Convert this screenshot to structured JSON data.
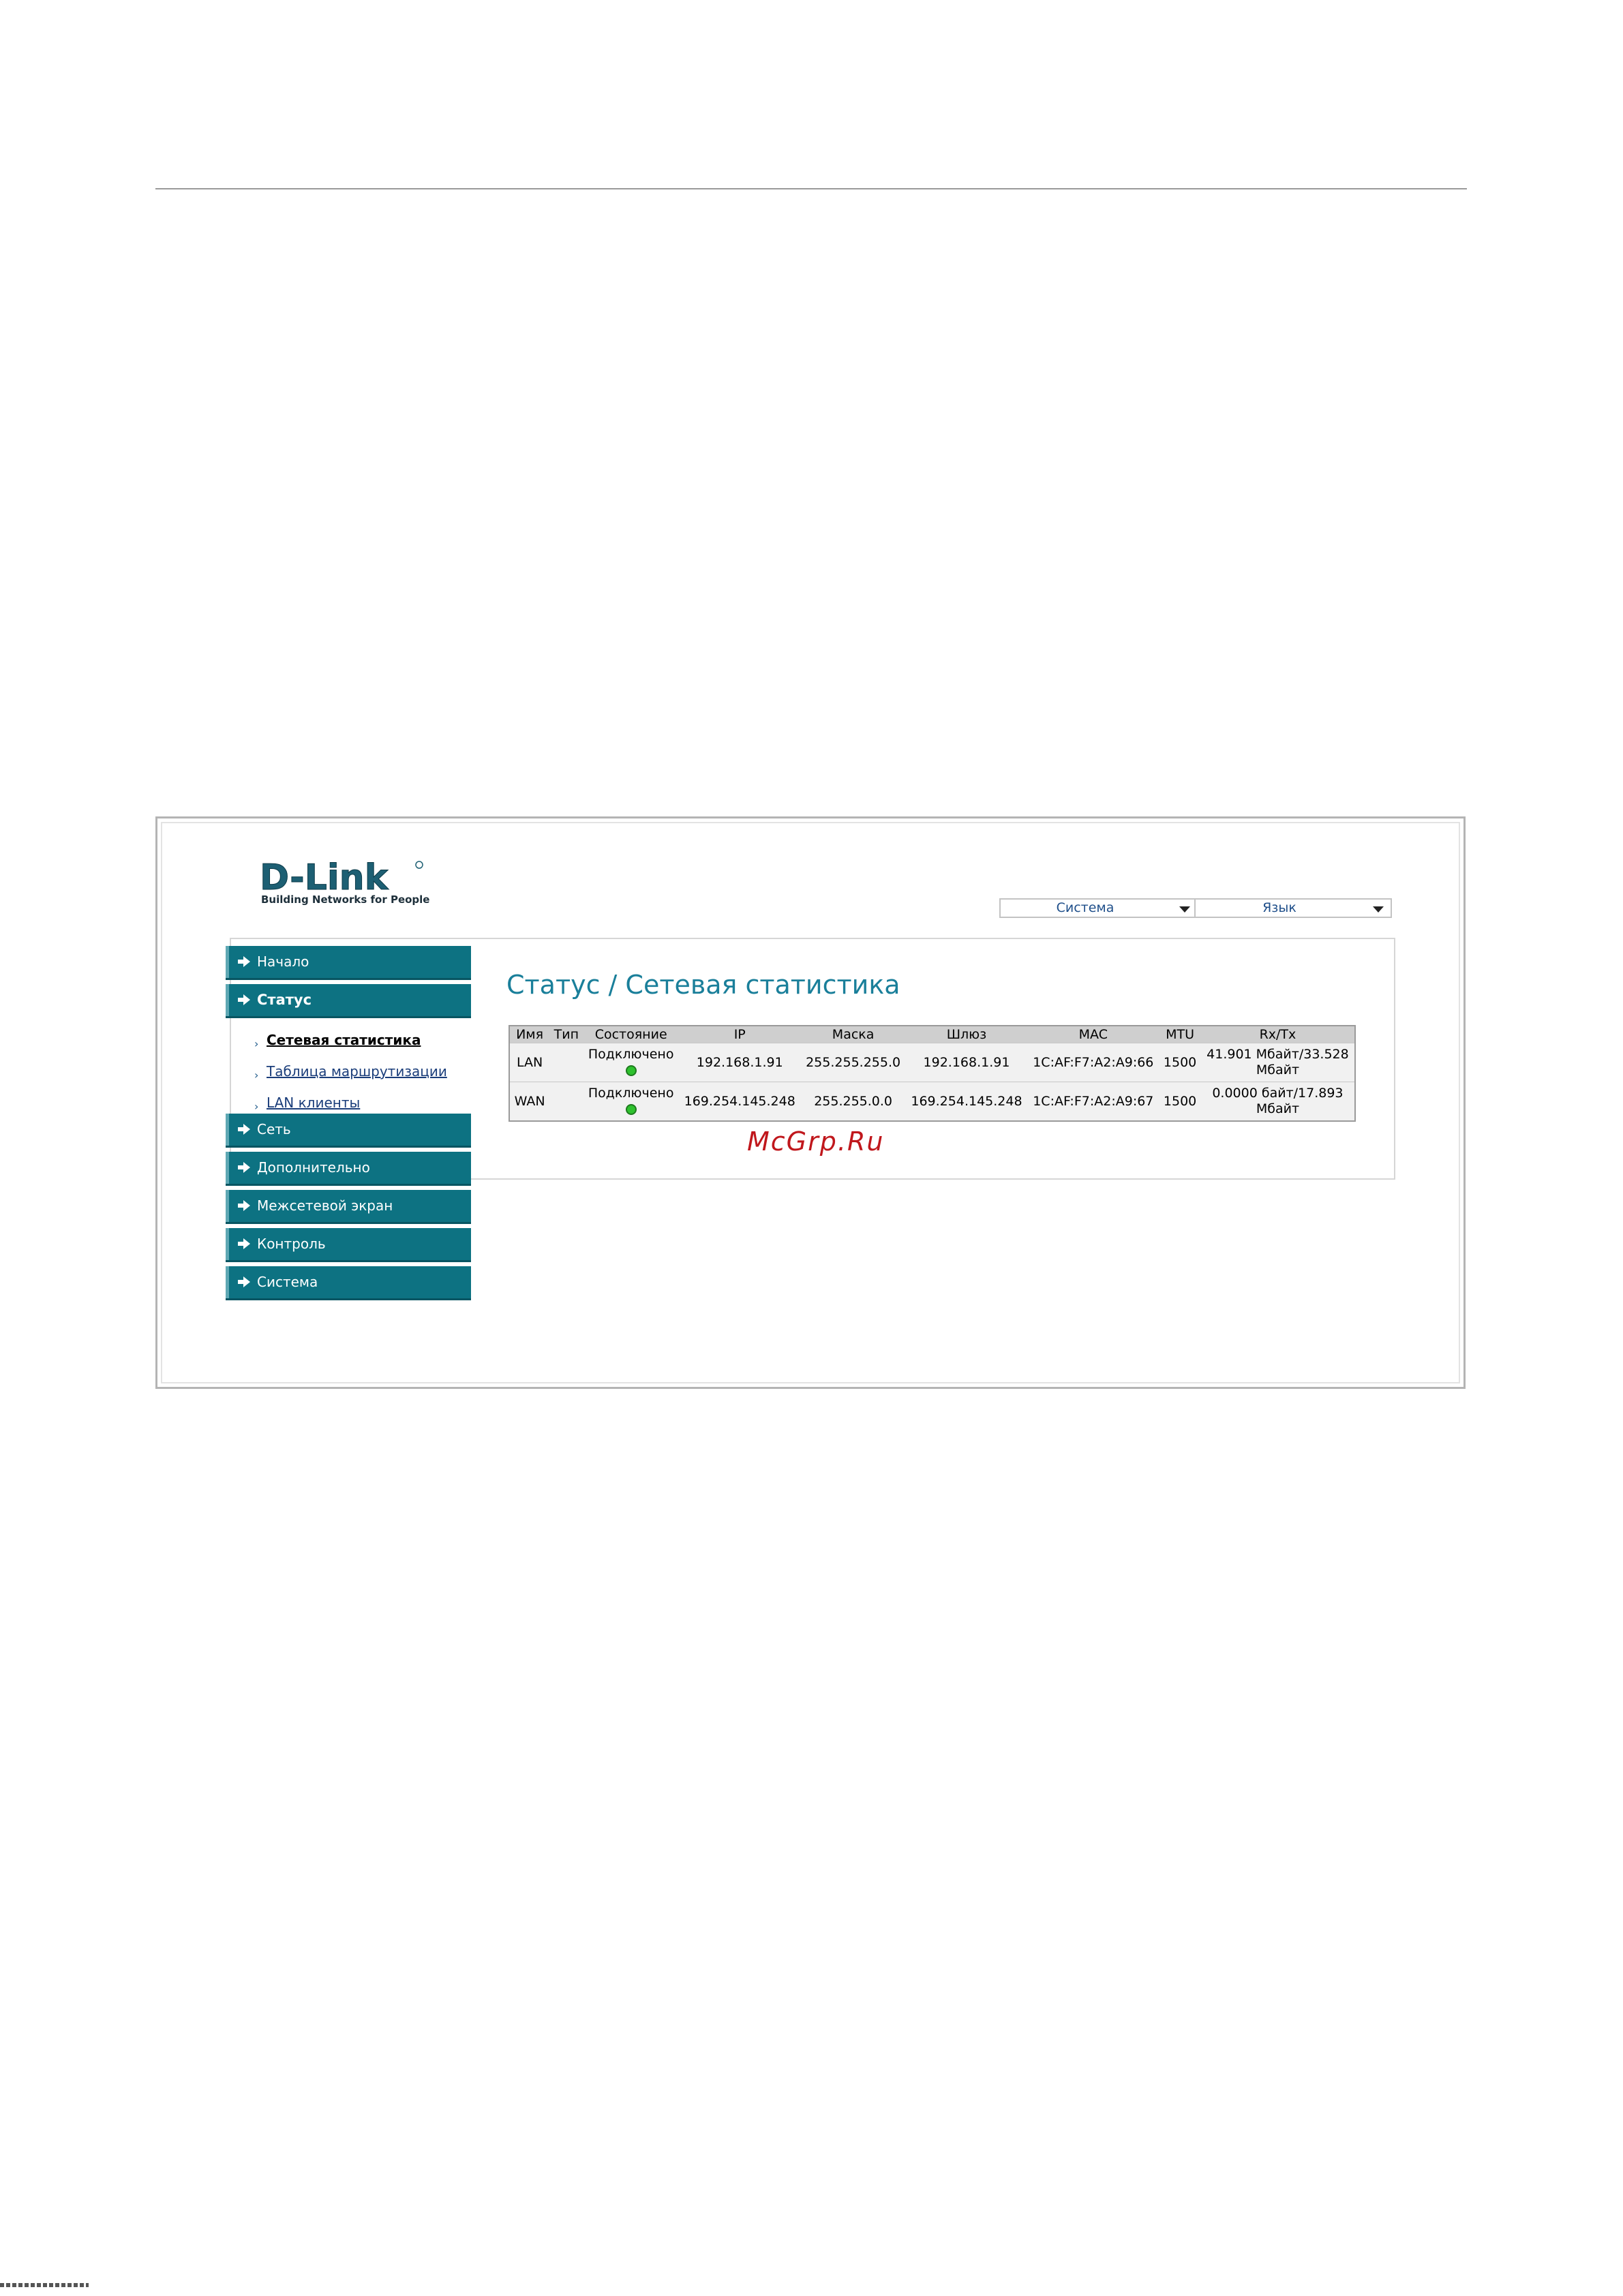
{
  "logo": {
    "brand": "D-Link",
    "tagline": "Building Networks for People"
  },
  "header": {
    "system_select": "Система",
    "language_select": "Язык"
  },
  "sidebar": {
    "items": [
      {
        "label": "Начало"
      },
      {
        "label": "Статус",
        "active": true,
        "subitems": [
          {
            "label": "Сетевая статистика",
            "current": true
          },
          {
            "label": "Таблица маршрутизации"
          },
          {
            "label": "LAN клиенты"
          }
        ]
      },
      {
        "label": "Сеть"
      },
      {
        "label": "Дополнительно"
      },
      {
        "label": "Межсетевой экран"
      },
      {
        "label": "Контроль"
      },
      {
        "label": "Система"
      }
    ]
  },
  "main": {
    "title": "Статус / Сетевая статистика",
    "table": {
      "headers": [
        "Имя",
        "Тип",
        "Состояние",
        "IP",
        "Маска",
        "Шлюз",
        "MAC",
        "MTU",
        "Rx/Tx"
      ],
      "rows": [
        {
          "name": "LAN",
          "type": "",
          "status": "Подключено",
          "ip": "192.168.1.91",
          "mask": "255.255.255.0",
          "gateway": "192.168.1.91",
          "mac": "1C:AF:F7:A2:A9:66",
          "mtu": "1500",
          "rxtx_1": "41.901 Мбайт/33.528",
          "rxtx_2": "Мбайт"
        },
        {
          "name": "WAN",
          "type": "",
          "status": "Подключено",
          "ip": "169.254.145.248",
          "mask": "255.255.0.0",
          "gateway": "169.254.145.248",
          "mac": "1C:AF:F7:A2:A9:67",
          "mtu": "1500",
          "rxtx_1": "0.0000 байт/17.893",
          "rxtx_2": "Мбайт"
        }
      ]
    }
  },
  "watermark": "McGrp.Ru",
  "colors": {
    "nav_bg": "#0d7282",
    "title": "#1a7f9a",
    "status_ok": "#2ec12e",
    "watermark": "#c0171c"
  }
}
